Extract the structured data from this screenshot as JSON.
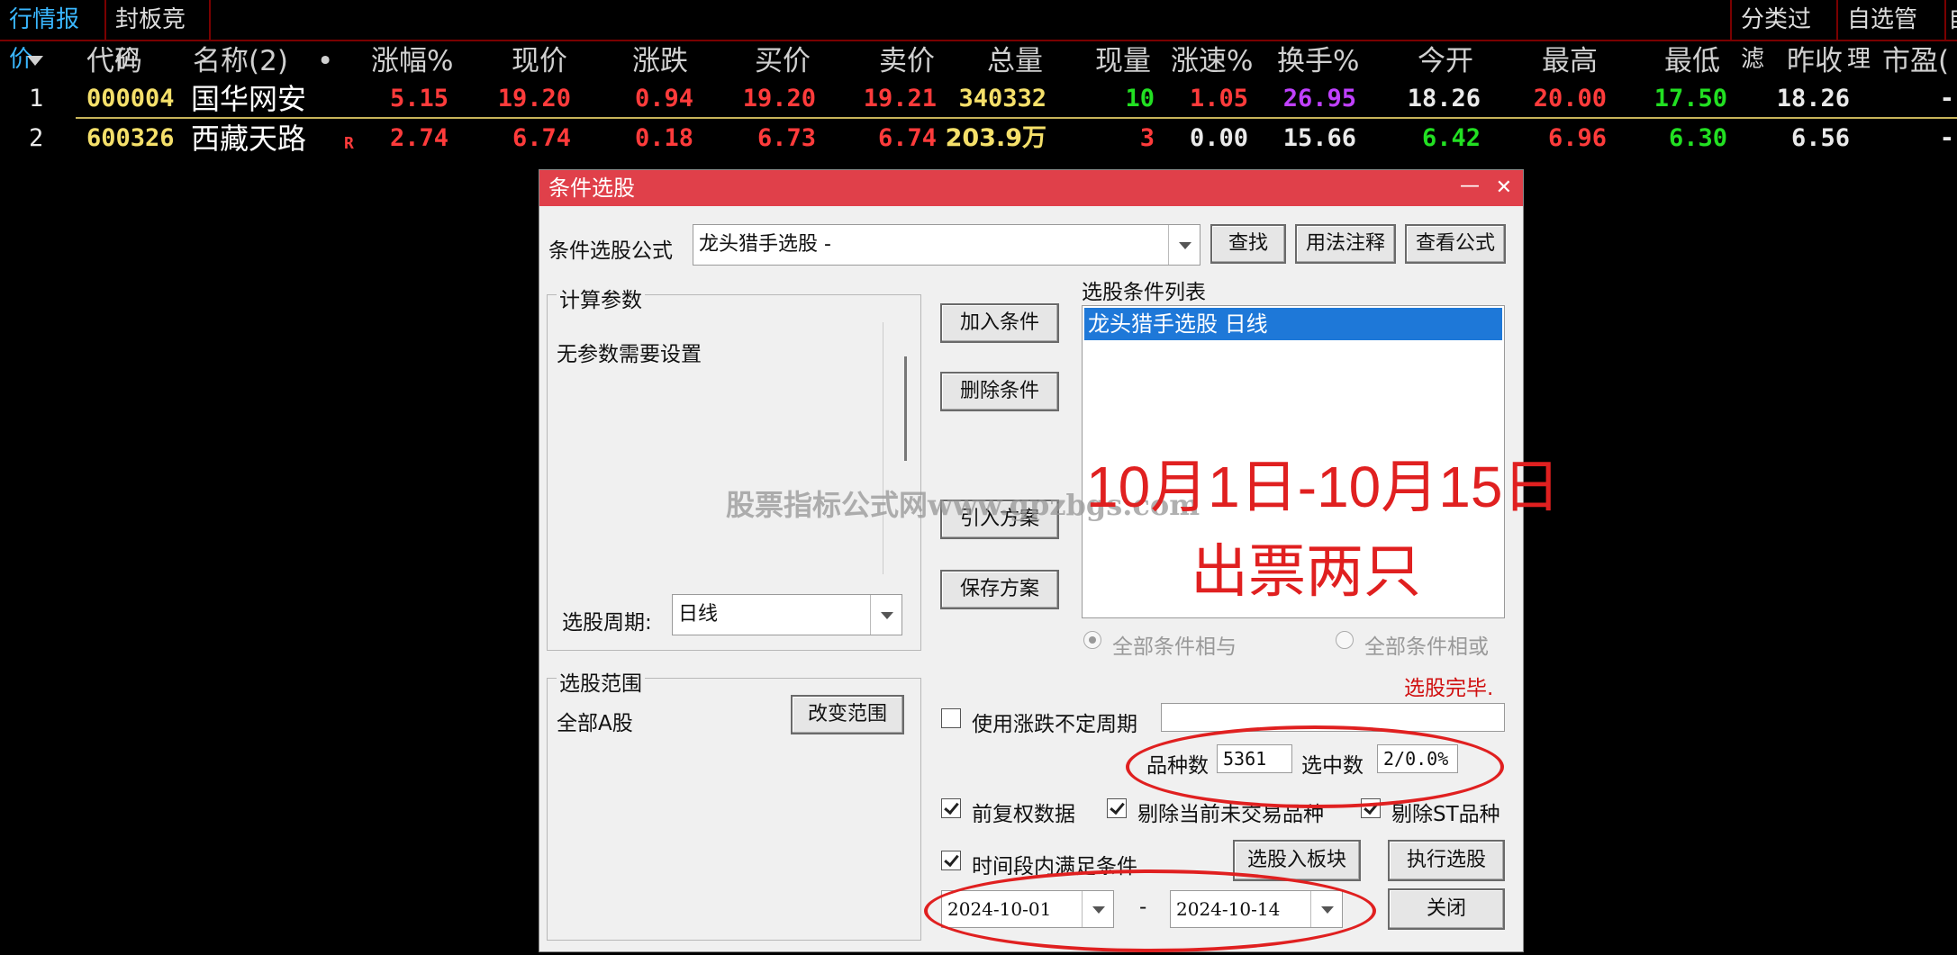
{
  "tabs": {
    "quote": "行情报价",
    "bidding": "封板竞价",
    "filter": "分类过滤",
    "self_manage": "自选管理",
    "partial": "自"
  },
  "columns": [
    "代码",
    "名称(2)",
    "•",
    "涨幅%",
    "现价",
    "涨跌",
    "买价",
    "卖价",
    "总量",
    "现量",
    "涨速%",
    "换手%",
    "今开",
    "最高",
    "最低",
    "昨收",
    "市盈("
  ],
  "rows": [
    {
      "idx": "1",
      "code": "000004",
      "name": "国华网安",
      "flag": "",
      "chg_pct": "5.15",
      "price": "19.20",
      "chg": "0.94",
      "bid": "19.20",
      "ask": "19.21",
      "volume": "340332",
      "cur_vol": "10",
      "speed": "1.05",
      "turnover": "26.95",
      "open": "18.26",
      "high": "20.00",
      "low": "17.50",
      "prev": "18.26",
      "pe": "-"
    },
    {
      "idx": "2",
      "code": "600326",
      "name": "西藏天路",
      "flag": "R",
      "chg_pct": "2.74",
      "price": "6.74",
      "chg": "0.18",
      "bid": "6.73",
      "ask": "6.74",
      "volume": "203.9万",
      "cur_vol": "3",
      "speed": "0.00",
      "turnover": "15.66",
      "open": "6.42",
      "high": "6.96",
      "low": "6.30",
      "prev": "6.56",
      "pe": "-"
    }
  ],
  "dialog": {
    "title": "条件选股",
    "minimize": "—",
    "close_x": "✕",
    "formula_label": "条件选股公式",
    "formula_value": "龙头猎手选股  -",
    "btn_find": "查找",
    "btn_usage": "用法注释",
    "btn_view": "查看公式",
    "params_group": "计算参数",
    "params_text": "无参数需要设置",
    "period_label": "选股周期:",
    "period_value": "日线",
    "btn_add": "加入条件",
    "btn_delete": "删除条件",
    "btn_import": "引入方案",
    "btn_save": "保存方案",
    "cond_list_label": "选股条件列表",
    "cond_item": "龙头猎手选股  日线",
    "radio_and": "全部条件相与",
    "radio_or": "全部条件相或",
    "status": "选股完毕.",
    "scope_group": "选股范围",
    "scope_value": "全部A股",
    "btn_change_scope": "改变范围",
    "use_period_label": "使用涨跌不定周期",
    "count_label": "品种数",
    "count_value": "5361",
    "selected_label": "选中数",
    "selected_value": "2/0.0%",
    "chk_forward": "前复权数据",
    "chk_exclude_untraded": "剔除当前未交易品种",
    "chk_exclude_st": "剔除ST品种",
    "chk_time_range": "时间段内满足条件",
    "btn_to_block": "选股入板块",
    "btn_execute": "执行选股",
    "date_from": "2024-10-01",
    "date_sep": "-",
    "date_to": "2024-10-14",
    "btn_close": "关闭"
  },
  "annotation": {
    "line1": "10月1日-10月15日",
    "line2": "出票两只"
  },
  "watermark": "股票指标公式网www.gpzbgs.com",
  "colors": {
    "up": "#ff3b3b",
    "down": "#22e022",
    "title_bar": "#e0404a",
    "annotation": "#e02020",
    "selection": "#1e78d8"
  }
}
